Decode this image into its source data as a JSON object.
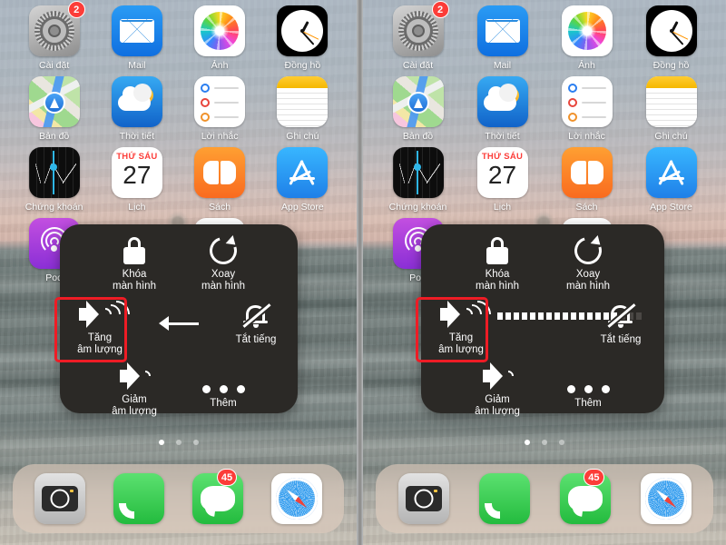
{
  "screenshot": {
    "title": "iOS AssistiveTouch volume control tutorial — two phone screens",
    "panels": [
      "before-tap",
      "after-tap"
    ]
  },
  "home_screen": {
    "rows": [
      [
        {
          "name": "settings-app",
          "label": "Cài đặt",
          "badge": "2"
        },
        {
          "name": "mail-app",
          "label": "Mail",
          "badge": ""
        },
        {
          "name": "photos-app",
          "label": "Ảnh",
          "badge": ""
        },
        {
          "name": "clock-app",
          "label": "Đồng hồ",
          "badge": ""
        }
      ],
      [
        {
          "name": "maps-app",
          "label": "Bản đồ",
          "badge": ""
        },
        {
          "name": "weather-app",
          "label": "Thời tiết",
          "badge": ""
        },
        {
          "name": "reminders-app",
          "label": "Lời nhắc",
          "badge": ""
        },
        {
          "name": "notes-app",
          "label": "Ghi chú",
          "badge": ""
        }
      ],
      [
        {
          "name": "stocks-app",
          "label": "Chứng khoán",
          "badge": ""
        },
        {
          "name": "calendar-app",
          "label": "Lịch",
          "badge": ""
        },
        {
          "name": "books-app",
          "label": "Sách",
          "badge": ""
        },
        {
          "name": "appstore-app",
          "label": "App Store",
          "badge": ""
        }
      ],
      [
        {
          "name": "podcasts-app",
          "label": "Pod",
          "badge": ""
        },
        {
          "name": "wallet-app",
          "label": "",
          "badge": ""
        },
        {
          "name": "home-app",
          "label": "",
          "badge": ""
        }
      ]
    ],
    "calendar": {
      "weekday": "THỨ SÁU",
      "day": "27"
    },
    "page_dots": {
      "count": 3,
      "active_index": 0
    },
    "dock": [
      {
        "name": "camera-app",
        "label": "Camera",
        "badge": ""
      },
      {
        "name": "phone-app",
        "label": "Điện thoại",
        "badge": ""
      },
      {
        "name": "messages-app",
        "label": "Tin nhắn",
        "badge": "45"
      },
      {
        "name": "safari-app",
        "label": "Safari",
        "badge": ""
      }
    ]
  },
  "assistive_touch": {
    "panel_color": "#2b2926",
    "highlight_color": "#ee1c25",
    "items": {
      "lock_screen": {
        "label_line1": "Khóa",
        "label_line2": "màn hình",
        "icon": "lock-icon"
      },
      "rotate_screen": {
        "label_line1": "Xoay",
        "label_line2": "màn hình",
        "icon": "rotate-icon"
      },
      "volume_up": {
        "label_line1": "Tăng",
        "label_line2": "âm lượng",
        "icon": "volume-up-icon"
      },
      "volume_down": {
        "label_line1": "Giảm",
        "label_line2": "âm lượng",
        "icon": "volume-down-icon"
      },
      "mute": {
        "label_line1": "Tắt tiếng",
        "label_line2": "",
        "icon": "bell-slash-icon"
      },
      "more": {
        "label_line1": "Thêm",
        "label_line2": "",
        "icon": "ellipsis-icon"
      },
      "back": {
        "label_line1": "",
        "label_line2": "",
        "icon": "back-arrow-icon"
      }
    }
  },
  "left_panel": {
    "center_icon": "back-arrow-icon",
    "highlighted_item": "volume_up"
  },
  "right_panel": {
    "center_icon": "volume-level-bar",
    "highlighted_item": "volume_up",
    "volume": {
      "segments_total": 18,
      "segments_filled": 15,
      "percent": 83
    }
  }
}
